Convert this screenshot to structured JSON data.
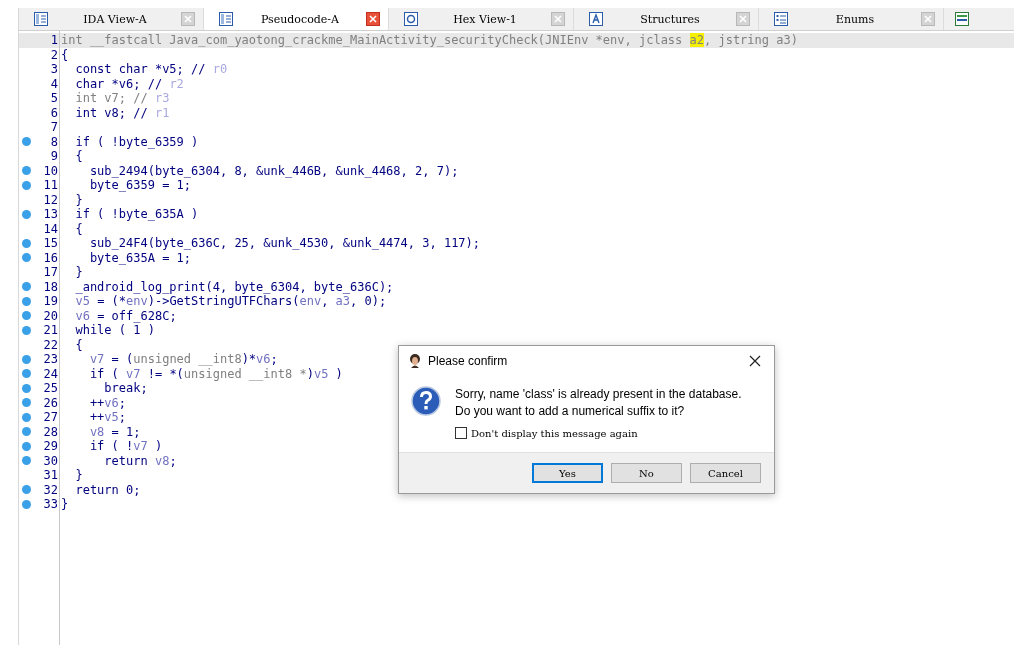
{
  "tabs": [
    {
      "label": "IDA View-A",
      "kind": "listing",
      "selected": false
    },
    {
      "label": "Pseudocode-A",
      "kind": "pseudocode",
      "selected": true
    },
    {
      "label": "Hex View-1",
      "kind": "hex",
      "selected": false
    },
    {
      "label": "Structures",
      "kind": "struct",
      "selected": false
    },
    {
      "label": "Enums",
      "kind": "enum",
      "selected": false
    }
  ],
  "code": {
    "lines": [
      {
        "number": "1",
        "breakpoint": false,
        "highlighted": true,
        "tokens": [
          {
            "text": "int __fastcall Java_com_yaotong_crackme_MainActivity_securityCheck(JNIEnv *env, jclass ",
            "kind": "dim"
          },
          {
            "text": "a2",
            "kind": "match"
          },
          {
            "text": ", jstring a3)",
            "kind": "dim"
          }
        ]
      },
      {
        "number": "2",
        "breakpoint": false,
        "highlighted": false,
        "tokens": [
          {
            "text": "{",
            "kind": "code"
          }
        ]
      },
      {
        "number": "3",
        "breakpoint": false,
        "highlighted": false,
        "tokens": [
          {
            "text": "  const char *v5; // ",
            "kind": "code"
          },
          {
            "text": "r0",
            "kind": "comment"
          }
        ]
      },
      {
        "number": "4",
        "breakpoint": false,
        "highlighted": false,
        "tokens": [
          {
            "text": "  char *v6; // ",
            "kind": "code"
          },
          {
            "text": "r2",
            "kind": "comment"
          }
        ]
      },
      {
        "number": "5",
        "breakpoint": false,
        "highlighted": false,
        "tokens": [
          {
            "text": "  int v7; // ",
            "kind": "dim"
          },
          {
            "text": "r3",
            "kind": "comment"
          }
        ]
      },
      {
        "number": "6",
        "breakpoint": false,
        "highlighted": false,
        "tokens": [
          {
            "text": "  int v8; // ",
            "kind": "code"
          },
          {
            "text": "r1",
            "kind": "comment"
          }
        ]
      },
      {
        "number": "7",
        "breakpoint": false,
        "highlighted": false
      },
      {
        "number": "8",
        "breakpoint": true,
        "highlighted": false,
        "tokens": [
          {
            "text": "  if ( !byte_6359 )",
            "kind": "code"
          }
        ]
      },
      {
        "number": "9",
        "breakpoint": false,
        "highlighted": false,
        "tokens": [
          {
            "text": "  {",
            "kind": "code"
          }
        ]
      },
      {
        "number": "10",
        "breakpoint": true,
        "highlighted": false,
        "tokens": [
          {
            "text": "    sub_2494(byte_6304, 8, &unk_446B, &unk_4468, 2, 7);",
            "kind": "code"
          }
        ]
      },
      {
        "number": "11",
        "breakpoint": true,
        "highlighted": false,
        "tokens": [
          {
            "text": "    byte_6359 = 1;",
            "kind": "code"
          }
        ]
      },
      {
        "number": "12",
        "breakpoint": false,
        "highlighted": false,
        "tokens": [
          {
            "text": "  }",
            "kind": "code"
          }
        ]
      },
      {
        "number": "13",
        "breakpoint": true,
        "highlighted": false,
        "tokens": [
          {
            "text": "  if ( !byte_635A )",
            "kind": "code"
          }
        ]
      },
      {
        "number": "14",
        "breakpoint": false,
        "highlighted": false,
        "tokens": [
          {
            "text": "  {",
            "kind": "code"
          }
        ]
      },
      {
        "number": "15",
        "breakpoint": true,
        "highlighted": false,
        "tokens": [
          {
            "text": "    sub_24F4(byte_636C, 25, &unk_4530, &unk_4474, 3, 117);",
            "kind": "code"
          }
        ]
      },
      {
        "number": "16",
        "breakpoint": true,
        "highlighted": false,
        "tokens": [
          {
            "text": "    byte_635A = 1;",
            "kind": "code"
          }
        ]
      },
      {
        "number": "17",
        "breakpoint": false,
        "highlighted": false,
        "tokens": [
          {
            "text": "  }",
            "kind": "code"
          }
        ]
      },
      {
        "number": "18",
        "breakpoint": true,
        "highlighted": false,
        "tokens": [
          {
            "text": "  _android_log_print(4, byte_6304, byte_636C);",
            "kind": "code"
          }
        ]
      },
      {
        "number": "19",
        "breakpoint": true,
        "highlighted": false,
        "tokens": [
          {
            "text": "  v5",
            "kind": "var"
          },
          {
            "text": " = (*",
            "kind": "code"
          },
          {
            "text": "env",
            "kind": "var"
          },
          {
            "text": ")->GetStringUTFChars(",
            "kind": "code"
          },
          {
            "text": "env",
            "kind": "var"
          },
          {
            "text": ", ",
            "kind": "code"
          },
          {
            "text": "a3",
            "kind": "var"
          },
          {
            "text": ", 0);",
            "kind": "code"
          }
        ]
      },
      {
        "number": "20",
        "breakpoint": true,
        "highlighted": false,
        "tokens": [
          {
            "text": "  v6",
            "kind": "var"
          },
          {
            "text": " = off_628C;",
            "kind": "code"
          }
        ]
      },
      {
        "number": "21",
        "breakpoint": true,
        "highlighted": false,
        "tokens": [
          {
            "text": "  while ( 1 )",
            "kind": "code"
          }
        ]
      },
      {
        "number": "22",
        "breakpoint": false,
        "highlighted": false,
        "tokens": [
          {
            "text": "  {",
            "kind": "code"
          }
        ]
      },
      {
        "number": "23",
        "breakpoint": true,
        "highlighted": false,
        "tokens": [
          {
            "text": "    v7",
            "kind": "var"
          },
          {
            "text": " = (",
            "kind": "code"
          },
          {
            "text": "unsigned __int8",
            "kind": "dim"
          },
          {
            "text": ")*",
            "kind": "code"
          },
          {
            "text": "v6",
            "kind": "var"
          },
          {
            "text": ";",
            "kind": "code"
          }
        ]
      },
      {
        "number": "24",
        "breakpoint": true,
        "highlighted": false,
        "tokens": [
          {
            "text": "    if ( ",
            "kind": "code"
          },
          {
            "text": "v7",
            "kind": "var"
          },
          {
            "text": " != *(",
            "kind": "code"
          },
          {
            "text": "unsigned __int8 *",
            "kind": "dim"
          },
          {
            "text": ")",
            "kind": "code"
          },
          {
            "text": "v5",
            "kind": "var"
          },
          {
            "text": " )",
            "kind": "code"
          }
        ]
      },
      {
        "number": "25",
        "breakpoint": true,
        "highlighted": false,
        "tokens": [
          {
            "text": "      break;",
            "kind": "code"
          }
        ]
      },
      {
        "number": "26",
        "breakpoint": true,
        "highlighted": false,
        "tokens": [
          {
            "text": "    ++",
            "kind": "code"
          },
          {
            "text": "v6",
            "kind": "var"
          },
          {
            "text": ";",
            "kind": "code"
          }
        ]
      },
      {
        "number": "27",
        "breakpoint": true,
        "highlighted": false,
        "tokens": [
          {
            "text": "    ++",
            "kind": "code"
          },
          {
            "text": "v5",
            "kind": "var"
          },
          {
            "text": ";",
            "kind": "code"
          }
        ]
      },
      {
        "number": "28",
        "breakpoint": true,
        "highlighted": false,
        "tokens": [
          {
            "text": "    v8",
            "kind": "var"
          },
          {
            "text": " = 1;",
            "kind": "code"
          }
        ]
      },
      {
        "number": "29",
        "breakpoint": true,
        "highlighted": false,
        "tokens": [
          {
            "text": "    if ( !",
            "kind": "code"
          },
          {
            "text": "v7",
            "kind": "var"
          },
          {
            "text": " )",
            "kind": "code"
          }
        ]
      },
      {
        "number": "30",
        "breakpoint": true,
        "highlighted": false,
        "tokens": [
          {
            "text": "      return ",
            "kind": "code"
          },
          {
            "text": "v8",
            "kind": "var"
          },
          {
            "text": ";",
            "kind": "code"
          }
        ]
      },
      {
        "number": "31",
        "breakpoint": false,
        "highlighted": false,
        "tokens": [
          {
            "text": "  }",
            "kind": "code"
          }
        ]
      },
      {
        "number": "32",
        "breakpoint": true,
        "highlighted": false,
        "tokens": [
          {
            "text": "  return 0;",
            "kind": "code"
          }
        ]
      },
      {
        "number": "33",
        "breakpoint": true,
        "highlighted": false,
        "tokens": [
          {
            "text": "}",
            "kind": "code"
          }
        ]
      }
    ]
  },
  "dialog": {
    "title": "Please confirm",
    "message": [
      "Sorry, name 'class' is already present in the database.",
      "Do you want to add a numerical suffix to it?"
    ],
    "checkbox": {
      "label": "Don't display this message again",
      "checked": false
    },
    "buttons": [
      {
        "label": "Yes",
        "default": true
      },
      {
        "label": "No",
        "default": false
      },
      {
        "label": "Cancel",
        "default": false
      }
    ]
  }
}
